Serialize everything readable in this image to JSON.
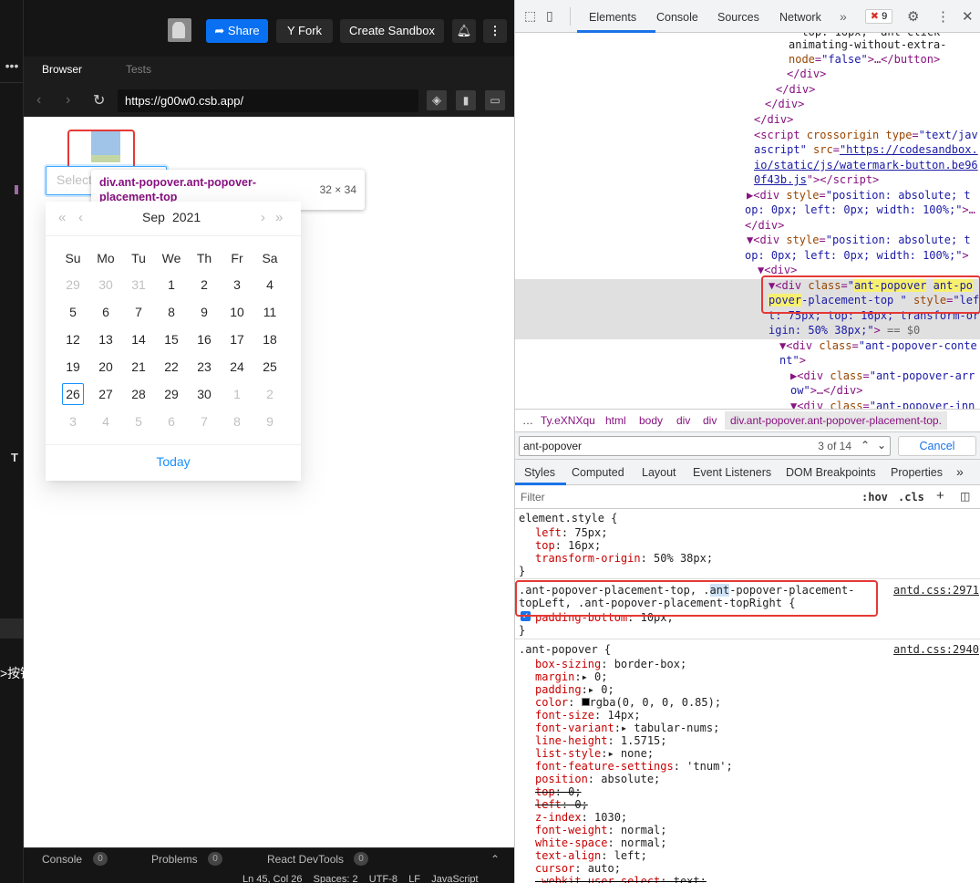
{
  "topbar": {
    "share": "Share",
    "fork": "Fork",
    "create_sandbox": "Create Sandbox"
  },
  "tabs": {
    "browser": "Browser",
    "tests": "Tests"
  },
  "url": "https://g00w0.csb.app/",
  "left_panel": {
    "text_char": ">按钮"
  },
  "bottom": {
    "console": "Console",
    "console_count": "0",
    "problems": "Problems",
    "problems_count": "0",
    "react_devtools": "React DevTools",
    "react_count": "0"
  },
  "statusbar": {
    "text": "Ln 45, Col 26    Spaces: 2    UTF-8    LF    JavaScript"
  },
  "picker": {
    "placeholder": "Select"
  },
  "tooltip": {
    "selector": "div.ant-popover.ant-popover-placement-top",
    "size": "32 × 34"
  },
  "calendar": {
    "month": "Sep",
    "year": "2021",
    "weekdays": [
      "Su",
      "Mo",
      "Tu",
      "We",
      "Th",
      "Fr",
      "Sa"
    ],
    "days": [
      [
        "29",
        "30",
        "31",
        "1",
        "2",
        "3",
        "4"
      ],
      [
        "5",
        "6",
        "7",
        "8",
        "9",
        "10",
        "11"
      ],
      [
        "12",
        "13",
        "14",
        "15",
        "16",
        "17",
        "18"
      ],
      [
        "19",
        "20",
        "21",
        "22",
        "23",
        "24",
        "25"
      ],
      [
        "26",
        "27",
        "28",
        "29",
        "30",
        "1",
        "2"
      ],
      [
        "3",
        "4",
        "5",
        "6",
        "7",
        "8",
        "9"
      ]
    ],
    "today_label": "Today",
    "today_value": "26"
  },
  "devtools": {
    "tabs": [
      "Elements",
      "Console",
      "Sources",
      "Network"
    ],
    "error_count": "9",
    "breadcrumbs": [
      "…",
      "Ty.eXNXqu",
      "html",
      "body",
      "div",
      "div",
      "div.ant-popover.ant-popover-placement-top."
    ],
    "search": {
      "value": "ant-popover",
      "count": "3 of 14",
      "cancel": "Cancel"
    },
    "style_tabs": [
      "Styles",
      "Computed",
      "Layout",
      "Event Listeners",
      "DOM Breakpoints",
      "Properties"
    ],
    "filter_placeholder": "Filter",
    "hov": ":hov",
    "cls": ".cls",
    "rule1_source": "antd.css:2971",
    "rule2_source": "antd.css:2940"
  },
  "colors": {
    "accent": "#1890ff",
    "share": "#0971f1",
    "highlight_box": "#e53935"
  }
}
